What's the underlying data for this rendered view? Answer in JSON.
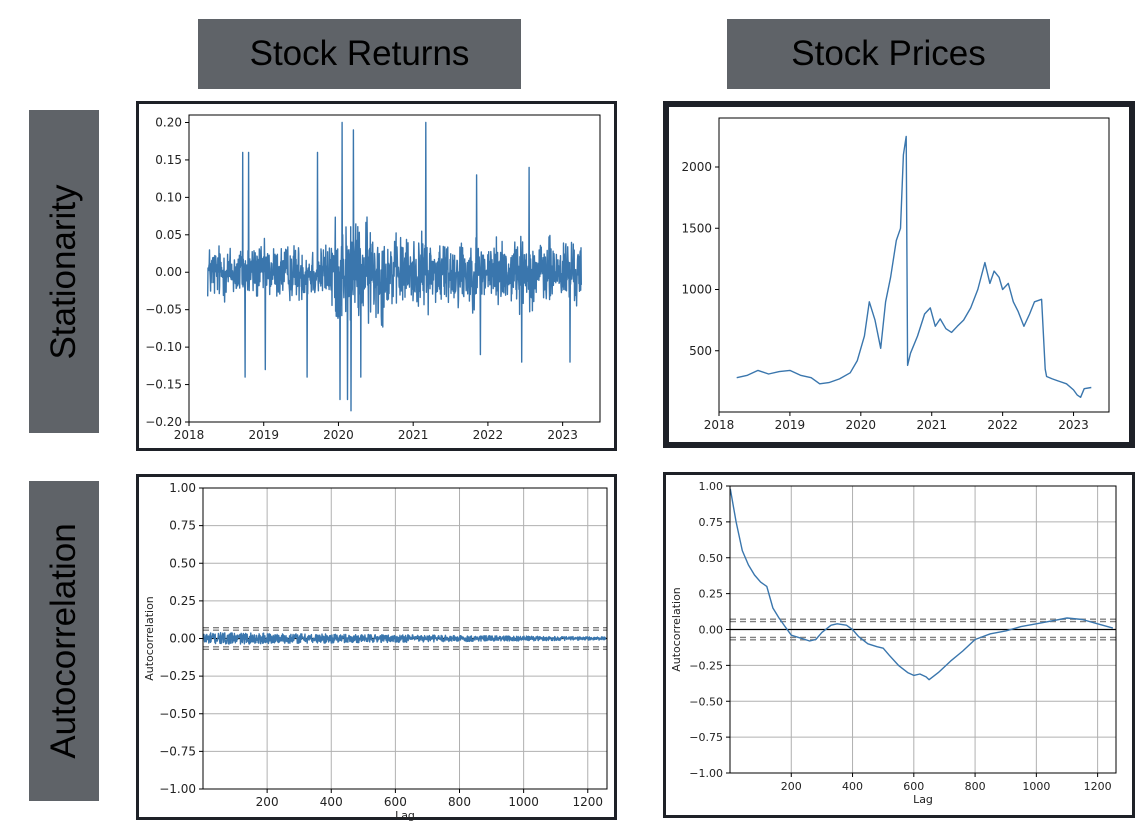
{
  "headers": {
    "col1": "Stock Returns",
    "col2": "Stock Prices",
    "row1": "Stationarity",
    "row2": "Autocorrelation"
  },
  "colors": {
    "header_bg": "#5f6368",
    "panel_border": "#1e2128",
    "series": "#3a76ad",
    "grid": "#b0b0b0",
    "band": "#808080",
    "zero_line": "#000000"
  },
  "chart_data": [
    {
      "id": "returns-ts",
      "type": "line",
      "title": "",
      "xlabel": "",
      "ylabel": "",
      "xlim": [
        2018.0,
        2023.5
      ],
      "ylim": [
        -0.2,
        0.21
      ],
      "xticks": [
        2018,
        2019,
        2020,
        2021,
        2022,
        2023
      ],
      "xtick_labels": [
        "2018",
        "2019",
        "2020",
        "2021",
        "2022",
        "2023"
      ],
      "yticks": [
        -0.2,
        -0.15,
        -0.1,
        -0.05,
        0.0,
        0.05,
        0.1,
        0.15,
        0.2
      ],
      "ytick_labels": [
        "−0.20",
        "−0.15",
        "−0.10",
        "−0.05",
        "0.00",
        "0.05",
        "0.10",
        "0.15",
        "0.20"
      ],
      "grid": false,
      "x_range": [
        2018.25,
        2023.25
      ],
      "noise_level": 0.03,
      "volatility_regimes": [
        {
          "x": [
            2018.25,
            2019.9
          ],
          "sd": 0.025
        },
        {
          "x": [
            2019.9,
            2020.6
          ],
          "sd": 0.045
        },
        {
          "x": [
            2020.6,
            2021.7
          ],
          "sd": 0.032
        },
        {
          "x": [
            2021.7,
            2023.25
          ],
          "sd": 0.03
        }
      ],
      "spikes": [
        {
          "x": 2018.72,
          "y": 0.16
        },
        {
          "x": 2018.8,
          "y": 0.16
        },
        {
          "x": 2019.72,
          "y": 0.16
        },
        {
          "x": 2020.05,
          "y": 0.2
        },
        {
          "x": 2020.2,
          "y": 0.19
        },
        {
          "x": 2021.17,
          "y": 0.2
        },
        {
          "x": 2021.85,
          "y": 0.13
        },
        {
          "x": 2022.55,
          "y": 0.14
        },
        {
          "x": 2018.75,
          "y": -0.14
        },
        {
          "x": 2019.02,
          "y": -0.13
        },
        {
          "x": 2019.58,
          "y": -0.14
        },
        {
          "x": 2020.02,
          "y": -0.17
        },
        {
          "x": 2020.12,
          "y": -0.17
        },
        {
          "x": 2020.17,
          "y": -0.185
        },
        {
          "x": 2020.3,
          "y": -0.14
        },
        {
          "x": 2021.9,
          "y": -0.11
        },
        {
          "x": 2022.45,
          "y": -0.12
        },
        {
          "x": 2023.1,
          "y": -0.12
        }
      ]
    },
    {
      "id": "prices-ts",
      "type": "line",
      "title": "",
      "xlabel": "",
      "ylabel": "",
      "xlim": [
        2018.0,
        2023.5
      ],
      "ylim": [
        0,
        2400
      ],
      "xticks": [
        2018,
        2019,
        2020,
        2021,
        2022,
        2023
      ],
      "xtick_labels": [
        "2018",
        "2019",
        "2020",
        "2021",
        "2022",
        "2023"
      ],
      "yticks": [
        500,
        1000,
        1500,
        2000
      ],
      "ytick_labels": [
        "500",
        "1000",
        "1500",
        "2000"
      ],
      "grid": false,
      "x": [
        2018.25,
        2018.4,
        2018.55,
        2018.7,
        2018.85,
        2019.0,
        2019.15,
        2019.3,
        2019.42,
        2019.55,
        2019.7,
        2019.85,
        2019.95,
        2020.05,
        2020.12,
        2020.2,
        2020.28,
        2020.35,
        2020.42,
        2020.5,
        2020.56,
        2020.6,
        2020.64,
        2020.66,
        2020.7,
        2020.8,
        2020.9,
        2020.98,
        2021.05,
        2021.12,
        2021.2,
        2021.28,
        2021.36,
        2021.45,
        2021.55,
        2021.65,
        2021.75,
        2021.82,
        2021.88,
        2021.95,
        2022.0,
        2022.08,
        2022.15,
        2022.22,
        2022.3,
        2022.38,
        2022.45,
        2022.55,
        2022.6,
        2022.62,
        2022.7,
        2022.8,
        2022.9,
        2023.0,
        2023.05,
        2023.1,
        2023.15,
        2023.25
      ],
      "y": [
        280,
        300,
        340,
        310,
        330,
        340,
        300,
        280,
        230,
        240,
        270,
        320,
        420,
        620,
        900,
        750,
        520,
        900,
        1100,
        1400,
        1500,
        2100,
        2250,
        380,
        480,
        620,
        800,
        850,
        700,
        760,
        680,
        650,
        700,
        750,
        850,
        1000,
        1220,
        1050,
        1150,
        1100,
        1000,
        1050,
        900,
        820,
        700,
        800,
        900,
        920,
        350,
        290,
        270,
        250,
        230,
        180,
        140,
        120,
        190,
        200
      ]
    },
    {
      "id": "returns-acf",
      "type": "line",
      "title": "",
      "xlabel": "Lag",
      "ylabel": "Autocorrelation",
      "xlim": [
        0,
        1260
      ],
      "ylim": [
        -1.0,
        1.0
      ],
      "xticks": [
        200,
        400,
        600,
        800,
        1000,
        1200
      ],
      "xtick_labels": [
        "200",
        "400",
        "600",
        "800",
        "1000",
        "1200"
      ],
      "yticks": [
        -1.0,
        -0.75,
        -0.5,
        -0.25,
        0.0,
        0.25,
        0.5,
        0.75,
        1.0
      ],
      "ytick_labels": [
        "−1.00",
        "−0.75",
        "−0.50",
        "−0.25",
        "0.00",
        "0.25",
        "0.50",
        "0.75",
        "1.00"
      ],
      "grid": true,
      "confidence_bands": [
        0.055,
        0.072,
        -0.055,
        -0.072
      ],
      "x_range": [
        1,
        1255
      ],
      "noise_amplitude_start": 0.04,
      "noise_amplitude_end": 0.01
    },
    {
      "id": "prices-acf",
      "type": "line",
      "title": "",
      "xlabel": "Lag",
      "ylabel": "Autocorrelation",
      "xlim": [
        0,
        1260
      ],
      "ylim": [
        -1.0,
        1.0
      ],
      "xticks": [
        200,
        400,
        600,
        800,
        1000,
        1200
      ],
      "xtick_labels": [
        "200",
        "400",
        "600",
        "800",
        "1000",
        "1200"
      ],
      "yticks": [
        -1.0,
        -0.75,
        -0.5,
        -0.25,
        0.0,
        0.25,
        0.5,
        0.75,
        1.0
      ],
      "ytick_labels": [
        "−1.00",
        "−0.75",
        "−0.50",
        "−0.25",
        "0.00",
        "0.25",
        "0.50",
        "0.75",
        "1.00"
      ],
      "grid": true,
      "confidence_bands": [
        0.055,
        0.072,
        -0.055,
        -0.072
      ],
      "x": [
        1,
        20,
        40,
        60,
        80,
        100,
        120,
        140,
        160,
        180,
        200,
        230,
        260,
        280,
        300,
        330,
        350,
        380,
        400,
        420,
        450,
        480,
        500,
        520,
        550,
        580,
        600,
        620,
        640,
        650,
        680,
        720,
        760,
        800,
        850,
        900,
        950,
        1000,
        1050,
        1100,
        1150,
        1200,
        1250
      ],
      "y": [
        0.98,
        0.75,
        0.55,
        0.45,
        0.38,
        0.33,
        0.3,
        0.15,
        0.08,
        0.02,
        -0.04,
        -0.06,
        -0.08,
        -0.07,
        -0.02,
        0.03,
        0.04,
        0.03,
        0.0,
        -0.05,
        -0.1,
        -0.12,
        -0.13,
        -0.18,
        -0.25,
        -0.3,
        -0.32,
        -0.31,
        -0.33,
        -0.35,
        -0.3,
        -0.22,
        -0.15,
        -0.07,
        -0.03,
        -0.01,
        0.02,
        0.04,
        0.06,
        0.08,
        0.07,
        0.04,
        0.01
      ]
    }
  ]
}
